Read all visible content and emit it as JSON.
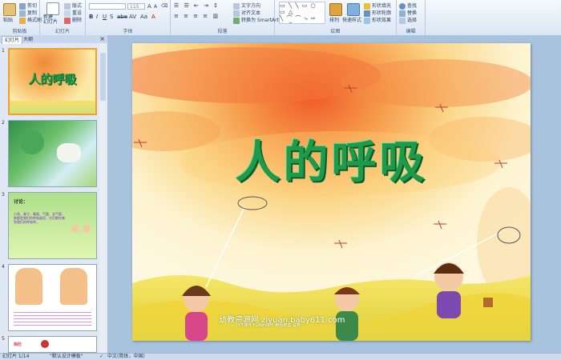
{
  "ribbon": {
    "clipboard": {
      "paste": "粘贴",
      "cut": "剪切",
      "copy": "复制",
      "format_painter": "格式刷",
      "label": "剪贴板"
    },
    "slides": {
      "new_slide": "新建\n幻灯片",
      "layout": "版式",
      "reset": "重设",
      "delete": "删除",
      "label": "幻灯片"
    },
    "font": {
      "font_size": "115",
      "label": "字体"
    },
    "paragraph": {
      "text_direction": "文字方向",
      "align_text": "对齐文本",
      "convert_smartart": "转换为 SmartArt",
      "label": "段落"
    },
    "drawing": {
      "arrange": "排列",
      "quick_styles": "快速样式",
      "shape_fill": "形状填充",
      "shape_outline": "形状轮廓",
      "shape_effects": "形状效果",
      "label": "绘图"
    },
    "editing": {
      "find": "查找",
      "replace": "替换",
      "select": "选择",
      "label": "编辑"
    }
  },
  "panel": {
    "tabs": [
      "幻灯片",
      "大纲"
    ],
    "close": "×",
    "slides": [
      {
        "number": "1",
        "title": "人的呼吸",
        "selected": true
      },
      {
        "number": "2",
        "title": ""
      },
      {
        "number": "3",
        "title": "讨论：",
        "body": "小孩、鼻子、喉咙、气管、支气管、肺都是我们的呼吸器官，它们都在做到我们的呼吸呼。"
      },
      {
        "number": "4",
        "title": ""
      },
      {
        "number": "5",
        "title": "胸腔"
      }
    ]
  },
  "slide": {
    "title": "人的呼吸",
    "watermark": "幼教资源网 ziyuan.baby611.com",
    "watermark_sub": "PPT课件   FLASH课件   教师教案   试卷"
  },
  "status": {
    "slide_position": "幻灯片 1/14",
    "theme": "\"默认设计模板\"",
    "language": "中文(简体，中国)"
  }
}
